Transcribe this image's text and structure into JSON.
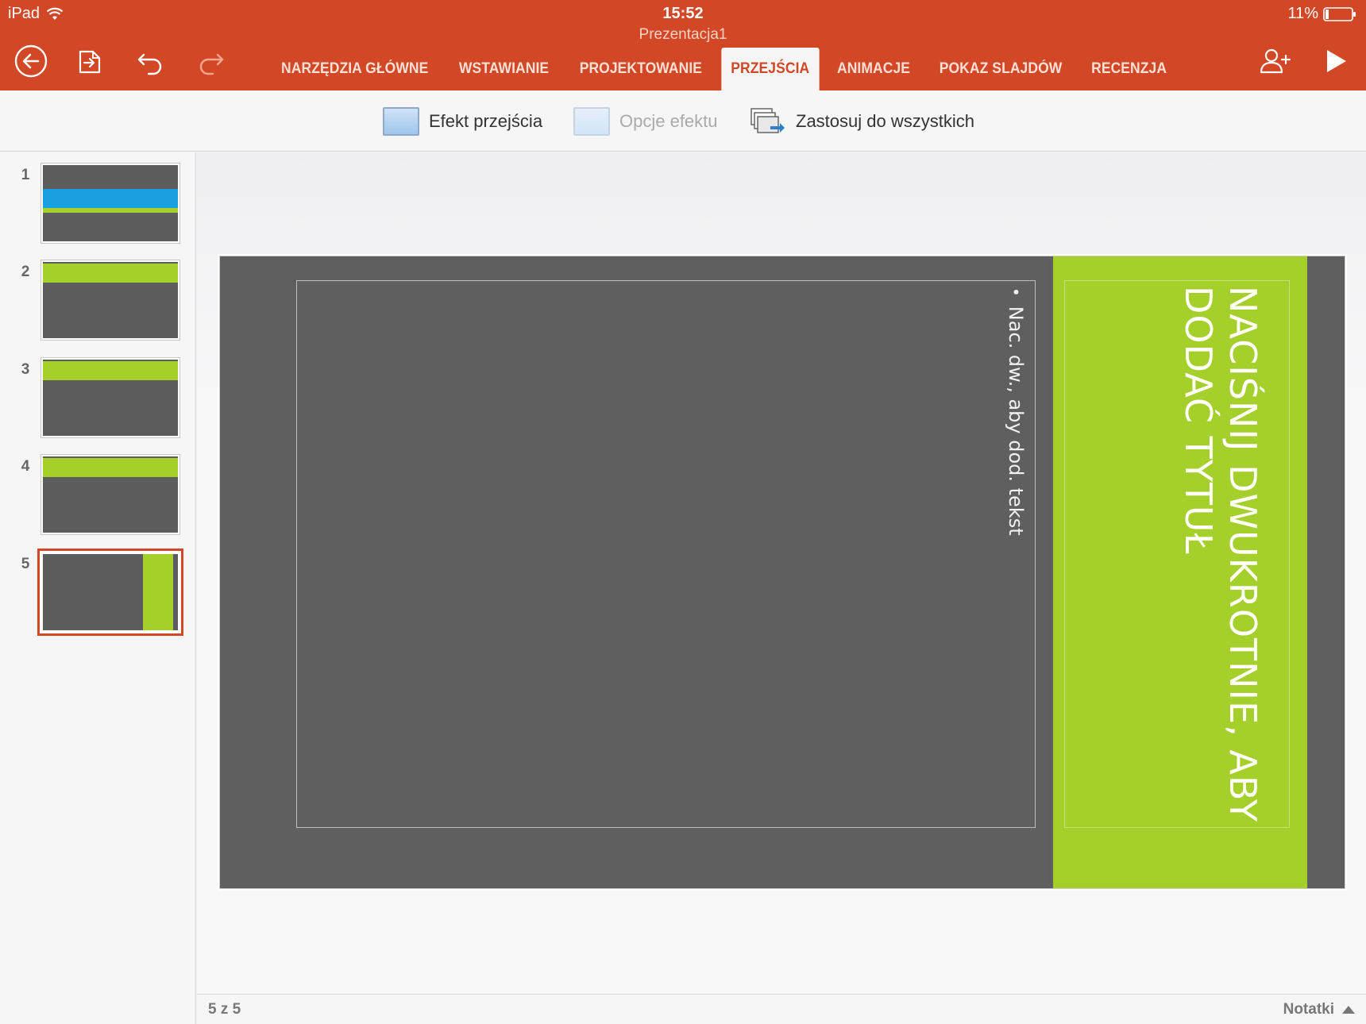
{
  "status": {
    "device": "iPad",
    "time": "15:52",
    "battery": "11%"
  },
  "document": {
    "title": "Prezentacja1"
  },
  "toolbar": {
    "icons": [
      "back-icon",
      "file-export-icon",
      "undo-icon",
      "redo-icon",
      "share-person-icon",
      "play-icon"
    ]
  },
  "tabs": [
    {
      "label": "NARZĘDZIA GŁÓWNE",
      "active": false
    },
    {
      "label": "WSTAWIANIE",
      "active": false
    },
    {
      "label": "PROJEKTOWANIE",
      "active": false
    },
    {
      "label": "PRZEJŚCIA",
      "active": true
    },
    {
      "label": "ANIMACJE",
      "active": false
    },
    {
      "label": "POKAZ SLAJDÓW",
      "active": false
    },
    {
      "label": "RECENZJA",
      "active": false
    }
  ],
  "ribbon": {
    "transition_effect": "Efekt przejścia",
    "effect_options": "Opcje efektu",
    "apply_to_all": "Zastosuj do wszystkich"
  },
  "slides": [
    {
      "number": "1"
    },
    {
      "number": "2"
    },
    {
      "number": "3"
    },
    {
      "number": "4"
    },
    {
      "number": "5",
      "selected": true
    }
  ],
  "slide": {
    "title": "NACIŚNIJ DWUKROTNIE, ABY DODAĆ TYTUŁ",
    "bullet": "•",
    "body": "Nac. dw., aby dod. tekst"
  },
  "footer": {
    "counter": "5 z 5",
    "notes": "Notatki"
  },
  "colors": {
    "accent": "#d24726",
    "slide_bg": "#5f5f5f",
    "slide_green": "#a5d02b",
    "thumb_blue": "#1aa0e0"
  }
}
